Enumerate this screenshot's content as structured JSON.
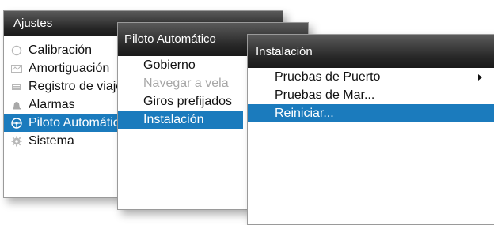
{
  "menus": {
    "ajustes": {
      "title": "Ajustes",
      "items": [
        {
          "label": "Calibración",
          "icon": "calibration-icon"
        },
        {
          "label": "Amortiguación",
          "icon": "damping-icon"
        },
        {
          "label": "Registro de viaje",
          "icon": "log-icon"
        },
        {
          "label": "Alarmas",
          "icon": "bell-icon"
        },
        {
          "label": "Piloto Automático",
          "icon": "steering-wheel-icon",
          "selected": true
        },
        {
          "label": "Sistema",
          "icon": "gear-icon"
        }
      ]
    },
    "piloto": {
      "title": "Piloto Automático",
      "items": [
        {
          "label": "Gobierno"
        },
        {
          "label": "Navegar a vela",
          "disabled": true
        },
        {
          "label": "Giros prefijados"
        },
        {
          "label": "Instalación",
          "selected": true
        }
      ]
    },
    "instalacion": {
      "title": "Instalación",
      "items": [
        {
          "label": "Pruebas de Puerto",
          "has_submenu": true
        },
        {
          "label": "Pruebas de Mar..."
        },
        {
          "label": "Reiniciar...",
          "selected": true
        }
      ]
    }
  },
  "colors": {
    "selection": "#1b7bbd",
    "title_bar": "#262626",
    "disabled_text": "#a6a6a6"
  }
}
